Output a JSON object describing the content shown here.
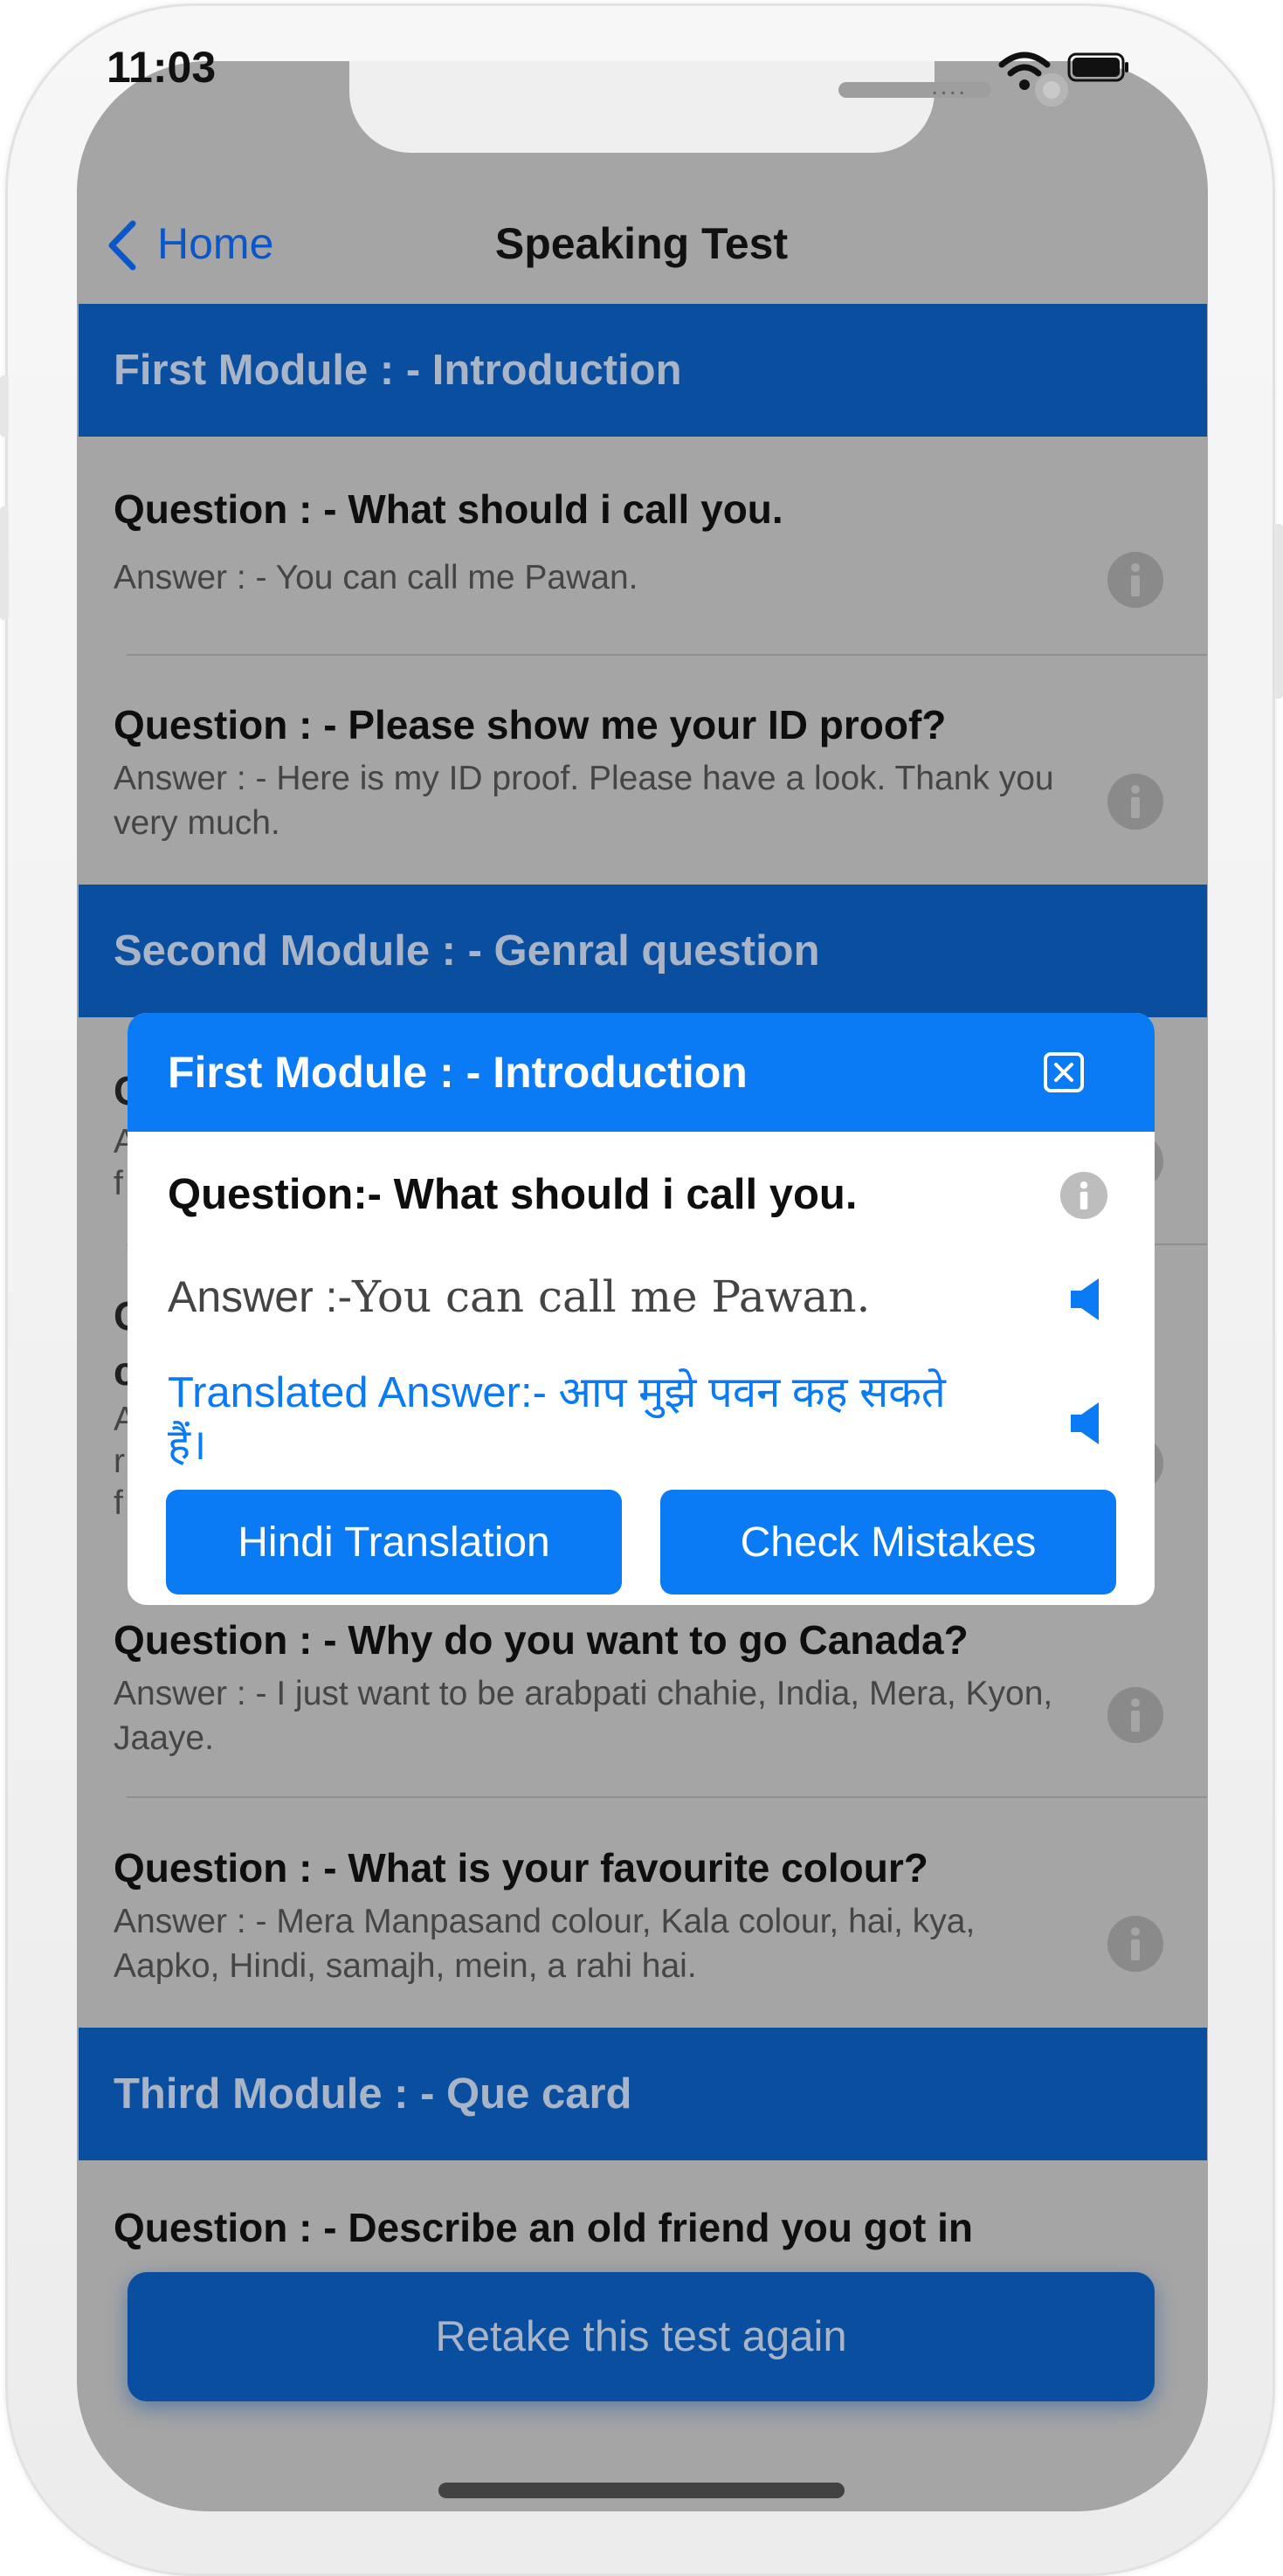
{
  "status_bar": {
    "time": "11:03",
    "signal_dots": "...."
  },
  "nav": {
    "back_label": "Home",
    "title": "Speaking Test"
  },
  "sections": [
    {
      "title": "First Module : - Introduction"
    },
    {
      "title": "Second Module : - Genral question"
    },
    {
      "title": "Third Module : - Que card"
    }
  ],
  "rows": [
    {
      "question": "Question : - What should i call you.",
      "answer": "Answer : - You can call me Pawan."
    },
    {
      "question": "Question : - Please show me your ID proof?",
      "answer": "Answer : - Here is my ID proof. Please have a look. Thank you very much."
    },
    {
      "question": "Question : - Why do you want to go Canada?",
      "answer": "Answer : - I just want to be arabpati chahie, India, Mera, Kyon, Jaaye."
    },
    {
      "question": "Question : - What is your favourite colour?",
      "answer": "Answer : - Mera Manpasand colour, Kala colour, hai, kya, Aapko, Hindi, samajh, mein, a rahi hai."
    },
    {
      "question": "Question : - Describe an old friend you got in"
    }
  ],
  "obscured_fragments": {
    "r1_q": "C",
    "r1_a1": "A",
    "r1_a2": "f",
    "r2_q1": "C",
    "r2_q2": "c",
    "r2_a1": "A",
    "r2_a2": "r",
    "r2_a3": "f"
  },
  "retake_label": "Retake this test again",
  "modal": {
    "title": "First Module : - Introduction",
    "question": "Question:- What should i call you.",
    "answer_label": "Answer :-",
    "answer_text": "You can call me Pawan.",
    "translated": "Translated Answer:- आप मुझे पवन कह सकते हैं।",
    "hindi_button": "Hindi Translation",
    "mistakes_button": "Check Mistakes"
  },
  "colors": {
    "brand_blue": "#0a7af5",
    "section_blue": "#0a4ea0",
    "overlay_gray": "#a5a5a5"
  },
  "icons": [
    "chevron-left-icon",
    "info-icon",
    "close-icon",
    "speaker-icon",
    "wifi-icon",
    "battery-icon"
  ]
}
